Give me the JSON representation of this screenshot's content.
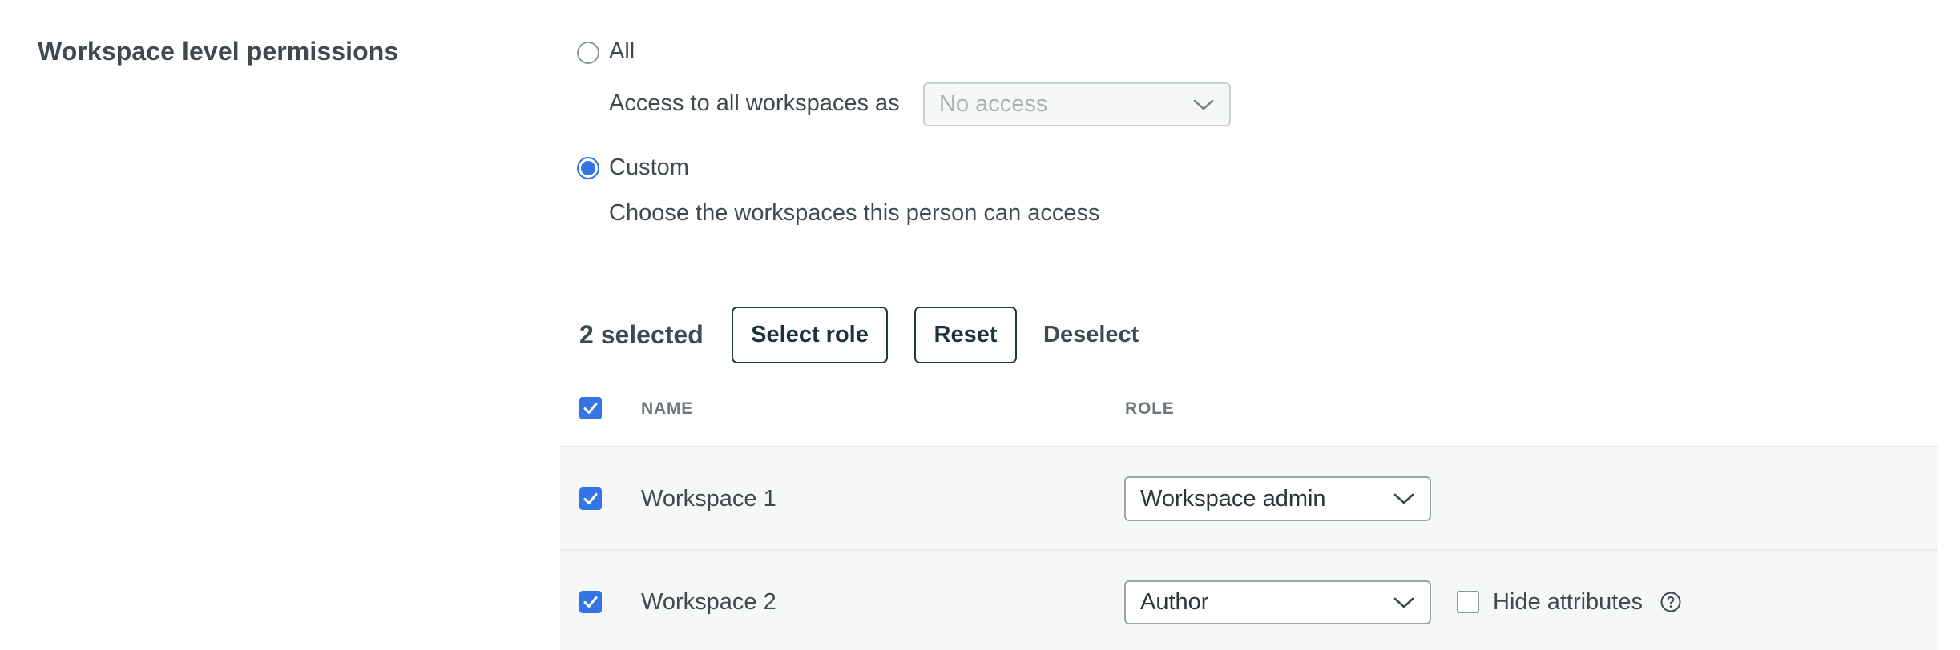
{
  "section": {
    "title": "Workspace level permissions"
  },
  "access_mode": {
    "options": [
      {
        "label": "All",
        "checked": false
      },
      {
        "label": "Custom",
        "checked": true
      }
    ],
    "all": {
      "label": "All",
      "helper": "Access to all workspaces as",
      "select": {
        "value": "No access",
        "disabled": true
      }
    },
    "custom": {
      "label": "Custom",
      "helper": "Choose the workspaces this person can access"
    }
  },
  "bulk_actions": {
    "count_label": "2 selected",
    "select_role_label": "Select role",
    "reset_label": "Reset",
    "deselect_label": "Deselect"
  },
  "table": {
    "select_all_checked": true,
    "columns": [
      "NAME",
      "ROLE"
    ],
    "rows": [
      {
        "name": "Workspace 1",
        "checked": true,
        "role": "Workspace admin",
        "hide_attributes": null
      },
      {
        "name": "Workspace 2",
        "checked": true,
        "role": "Author",
        "hide_attributes": {
          "label": "Hide attributes",
          "checked": false
        }
      }
    ]
  },
  "icons": {
    "radio": "radio-button",
    "checkbox": "checkmark",
    "select": "chevron-down",
    "help": "question-circle"
  },
  "colors": {
    "accent": "#3474e8",
    "text": "#3f4a4e",
    "button_border": "#1f3a40",
    "row_background": "#f6f8f8",
    "divider": "#e8ecec"
  }
}
